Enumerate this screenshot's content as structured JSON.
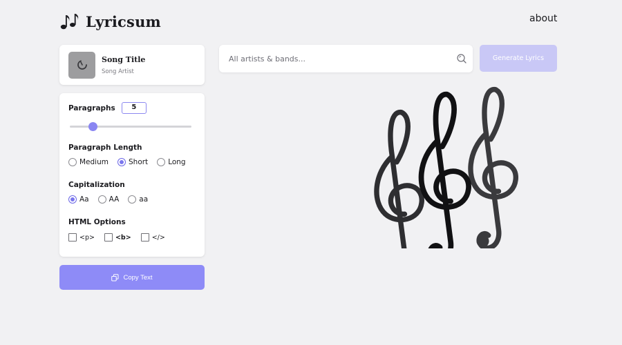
{
  "header": {
    "logo_icon": "music-notes-icon",
    "app_name": "Lyricsum",
    "about_label": "about"
  },
  "now_playing": {
    "album_icon": "spinner-icon",
    "title": "Song Title",
    "artist": "Song Artist"
  },
  "options": {
    "paragraphs": {
      "label": "Paragraphs",
      "value": "5",
      "slider_fraction": 0.19
    },
    "paragraph_length": {
      "label": "Paragraph Length",
      "choices": [
        "Medium",
        "Short",
        "Long"
      ],
      "selected": "Short"
    },
    "capitalization": {
      "label": "Capitalization",
      "choices": [
        "Aa",
        "AA",
        "aa"
      ],
      "selected": "Aa"
    },
    "html_options": {
      "label": "HTML Options",
      "choices": [
        "<p>",
        "<b>",
        "</>"
      ]
    }
  },
  "copy_button": {
    "icon": "copy-icon",
    "label": "Copy Text"
  },
  "search": {
    "placeholder": "All artists & bands...",
    "value": "",
    "icon": "search-icon"
  },
  "generate_button": {
    "label": "Generate Lyrics"
  },
  "illustration": "treble-clefs",
  "colors": {
    "background": "#f1f1f3",
    "accent": "#8e8bf7",
    "accent_disabled": "#c9c8f6",
    "radio_checked": "#7b77ee"
  }
}
